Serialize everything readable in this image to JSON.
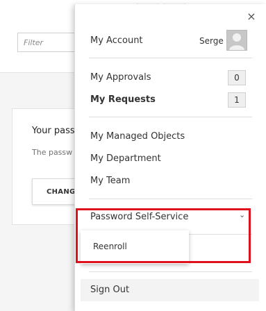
{
  "background": {
    "filter": {
      "placeholder": "Filter"
    },
    "card": {
      "title": "Your pass",
      "description": "The passw",
      "button_label": "CHANGE"
    }
  },
  "menu": {
    "account": {
      "label": "My Account",
      "username": "Serge"
    },
    "approvals": {
      "label": "My Approvals",
      "count": "0"
    },
    "requests": {
      "label": "My Requests",
      "count": "1"
    },
    "managed_objects": {
      "label": "My Managed Objects"
    },
    "department": {
      "label": "My Department"
    },
    "team": {
      "label": "My Team"
    },
    "password_self_service": {
      "label": "Password Self-Service",
      "submenu": {
        "reenroll_label": "Reenroll"
      }
    },
    "sign_out": {
      "label": "Sign Out"
    },
    "close_glyph": "×",
    "chevron_glyph": "⌄"
  },
  "colors": {
    "highlight": "#e0101c",
    "panel_background": "#ffffff",
    "badge_background": "#efefef",
    "signout_background": "#f3f3f3"
  }
}
